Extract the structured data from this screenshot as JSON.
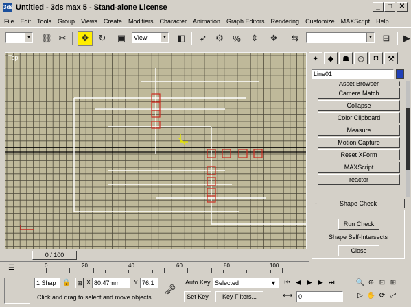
{
  "window": {
    "title": "Untitled   - 3ds max 5  - Stand-alone License",
    "app_icon": "3ds",
    "minimize": "_",
    "restore": "□",
    "close": "✕"
  },
  "menu": [
    "File",
    "Edit",
    "Tools",
    "Group",
    "Views",
    "Create",
    "Modifiers",
    "Character",
    "Animation",
    "Graph Editors",
    "Rendering",
    "Customize",
    "MAXScript",
    "Help"
  ],
  "toolbar": {
    "view_combo": "View",
    "selection_set_combo": ""
  },
  "viewport": {
    "label": "Top",
    "background": "#bfb99a",
    "grid_color": "#4f4b3c",
    "axis_color": "#000000",
    "spline_color": "#ffffff",
    "vertex_color": "#cc2a1e",
    "gizmo_color": "#e8e800"
  },
  "command_panel": {
    "object_name": "Line01",
    "object_color": "#2040b8",
    "utilities": [
      "Camera Match",
      "Collapse",
      "Color Clipboard",
      "Measure",
      "Motion Capture",
      "Reset XForm",
      "MAXScript",
      "reactor"
    ],
    "partial_top_label": "Asset Browser",
    "rollout_title": "Shape Check",
    "rollout_minus": "-",
    "rollout_buttons": [
      "Run Check",
      "Shape Self-Intersects",
      "Close"
    ]
  },
  "time": {
    "slider_label": "0 / 100",
    "ruler_labels": [
      "0",
      "20",
      "40",
      "60",
      "80",
      "100"
    ]
  },
  "status": {
    "selection": "1 Shap",
    "lock_icon": "lock-icon",
    "x_label": "X",
    "x_value": "80.47mm",
    "y_label": "Y",
    "y_value": "76.1",
    "prompt": "Click and drag to select and move objects",
    "auto_key_label": "Auto Key",
    "selected_combo": "Selected",
    "set_key_label": "Set Key",
    "key_filters_label": "Key Filters...",
    "frame_value": "0"
  }
}
